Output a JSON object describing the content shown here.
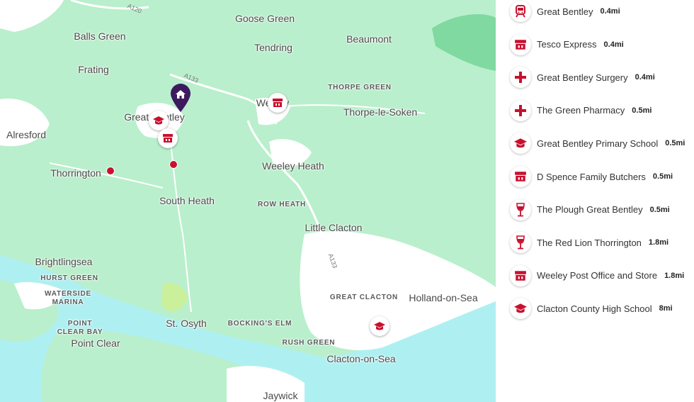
{
  "map": {
    "road_labels": [
      "A120",
      "A133",
      "A133"
    ],
    "places": {
      "goose_green": "Goose Green",
      "balls_green": "Balls Green",
      "beaumont": "Beaumont",
      "tendring": "Tendring",
      "frating": "Frating",
      "thorpe_green": "THORPE GREEN",
      "great_bentley": "Great Bentley",
      "weeley": "Weeley",
      "thorpe_le_soken": "Thorpe-le-Soken",
      "alresford": "Alresford",
      "thorrington": "Thorrington",
      "weeley_heath": "Weeley Heath",
      "south_heath": "South Heath",
      "row_heath": "ROW HEATH",
      "little_clacton": "Little Clacton",
      "brightlingsea": "Brightlingsea",
      "hurst_green": "HURST GREEN",
      "waterside_marina": "WATERSIDE\nMARINA",
      "great_clacton": "GREAT CLACTON",
      "holland_on_sea": "Holland-on-Sea",
      "point_clear_bay": "POINT\nCLEAR BAY",
      "st_osyth": "St. Osyth",
      "bockings_elm": "BOCKING'S ELM",
      "point_clear": "Point Clear",
      "rush_green": "RUSH GREEN",
      "clacton_on_sea": "Clacton-on-Sea",
      "jaywick": "Jaywick"
    }
  },
  "colors": {
    "accent": "#c8102e",
    "home_pin": "#3d1a5e",
    "land": "#b9efcc",
    "sea": "#aef0f2",
    "urban": "#ffffff"
  },
  "poi_list": [
    {
      "icon": "train-icon",
      "name": "Great Bentley",
      "distance": "0.4mi"
    },
    {
      "icon": "shop-icon",
      "name": "Tesco Express",
      "distance": "0.4mi"
    },
    {
      "icon": "medical-cross-icon",
      "name": "Great Bentley Surgery",
      "distance": "0.4mi"
    },
    {
      "icon": "medical-cross-icon",
      "name": "The Green Pharmacy",
      "distance": "0.5mi"
    },
    {
      "icon": "school-icon",
      "name": "Great Bentley Primary School",
      "distance": "0.5mi"
    },
    {
      "icon": "shop-icon",
      "name": "D Spence Family Butchers",
      "distance": "0.5mi"
    },
    {
      "icon": "wine-glass-icon",
      "name": "The Plough Great Bentley",
      "distance": "0.5mi"
    },
    {
      "icon": "wine-glass-icon",
      "name": "The Red Lion Thorrington",
      "distance": "1.8mi"
    },
    {
      "icon": "shop-icon",
      "name": "Weeley Post Office and Store",
      "distance": "1.8mi"
    },
    {
      "icon": "school-icon",
      "name": "Clacton County High School",
      "distance": "8mi"
    }
  ]
}
